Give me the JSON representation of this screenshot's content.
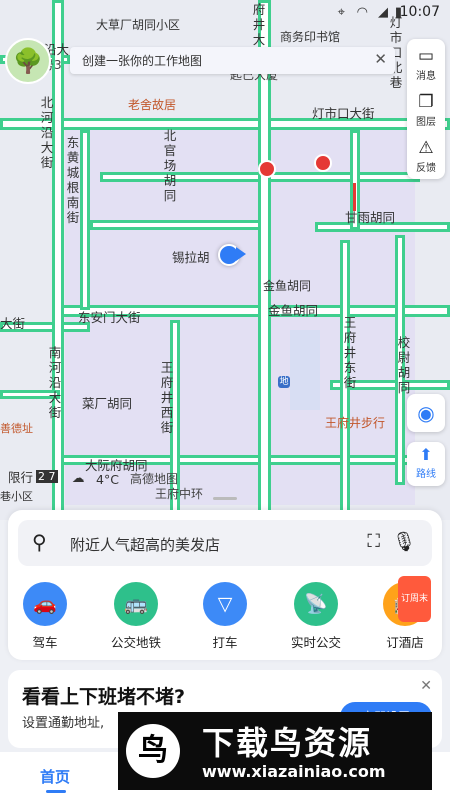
{
  "status_bar": {
    "time": "10:07"
  },
  "banner": {
    "text": "创建一张你的工作地图",
    "close": "✕"
  },
  "map": {
    "pois": {
      "alley_top": "大草厂胡同小区",
      "shangwu": "商务印书馆",
      "laoshe": "老舍故居",
      "jinyu": "金鱼胡同",
      "wangfujing_walk": "王府井步行",
      "gaode": "高德地图",
      "wangfu_center": "王府中环",
      "hao3": "号3",
      "yanzhao": "匙已大厦"
    },
    "roads": {
      "dengshikou": "灯市口大街",
      "beiheyan": "北河沿大街",
      "donghuangcheng": "东黄城根南街",
      "beiguanchang": "北官场胡同",
      "ganyu": "甘雨胡同",
      "xila": "锡拉胡",
      "dongan": "东安门大街",
      "jinyu_road": "金鱼胡同",
      "nanheyan": "南河沿大街",
      "caichang": "菜厂胡同",
      "wangfujing_xi": "王府井西街",
      "wangfujing_dong": "王府井东街",
      "xiaowei": "校尉胡同",
      "dayuanfu": "大阮府胡同",
      "dengshikou_bei": "灯市口北巷",
      "dajie_left": "大街",
      "yanmu": "沿大",
      "hutong_top": "府井大"
    },
    "side_texts": {
      "limit": "限行",
      "limit_nums": "2 7",
      "temp": "4°C",
      "left_small": "善德址",
      "left_small2": "巷小区"
    }
  },
  "tools": {
    "message": "消息",
    "layers": "图层",
    "feedback": "反馈",
    "route": "路线"
  },
  "search": {
    "placeholder": "附近人气超高的美发店"
  },
  "quick_actions": [
    {
      "label": "驾车",
      "icon": "car-icon",
      "color": "#3d8af7"
    },
    {
      "label": "公交地铁",
      "icon": "bus-icon",
      "color": "#2ec08b"
    },
    {
      "label": "打车",
      "icon": "taxi-icon",
      "color": "#3d8af7"
    },
    {
      "label": "实时公交",
      "icon": "realtime-bus-icon",
      "color": "#2ec08b"
    },
    {
      "label": "订酒店",
      "icon": "hotel-icon",
      "color": "#ffa21a",
      "badge": "订周末"
    }
  ],
  "promo": {
    "title": "看看上下班堵不堵?",
    "subtitle": "设置通勤地址,",
    "button": "立即设置"
  },
  "watermark": {
    "title": "下载鸟资源",
    "url": "www.xiazainiao.com",
    "logo_char": "鸟"
  },
  "nav": {
    "home": "首页"
  }
}
